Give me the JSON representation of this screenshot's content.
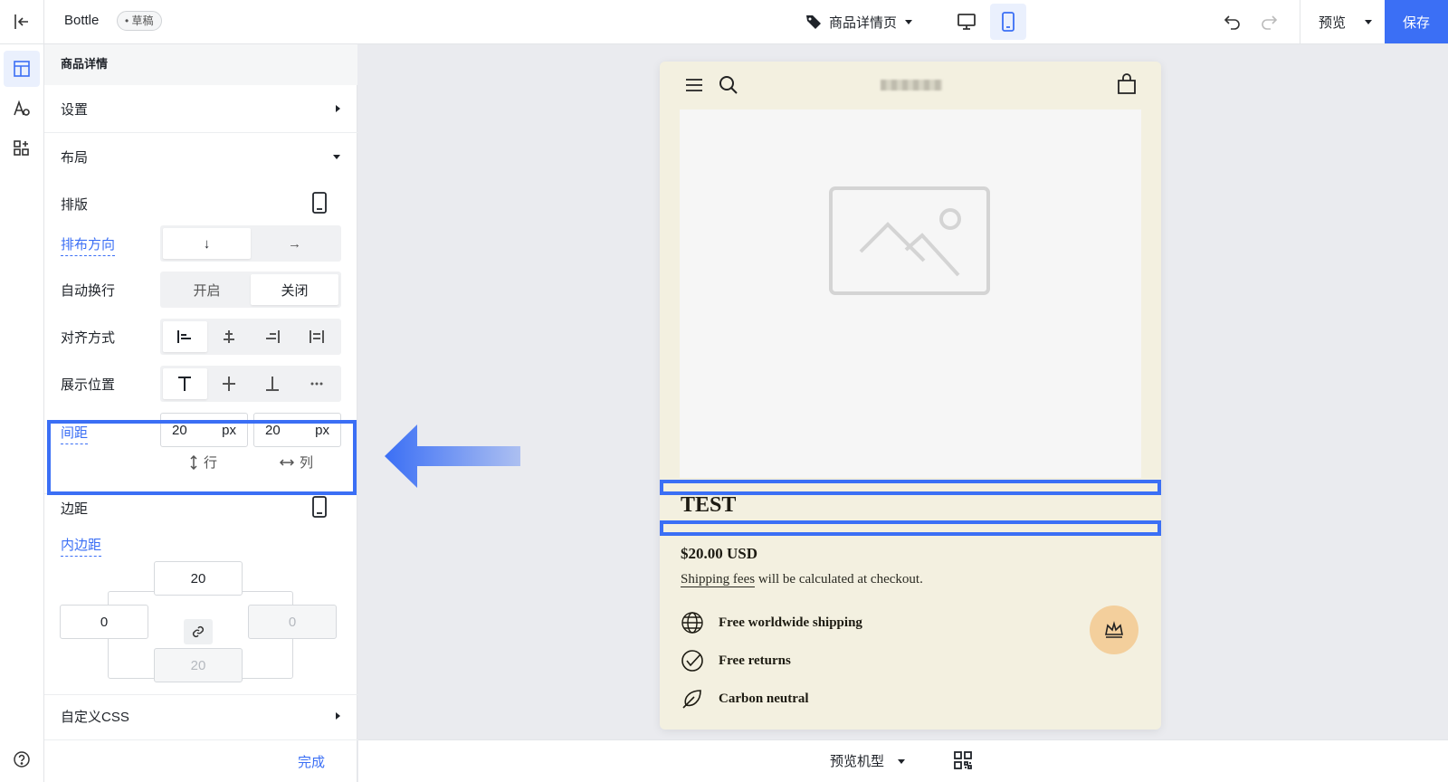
{
  "topbar": {
    "app_name": "Bottle",
    "draft_badge": "• 草稿",
    "page_selector": "商品详情页",
    "preview_label": "预览",
    "save_label": "保存"
  },
  "panel": {
    "header": "商品详情",
    "settings": "设置",
    "layout": "布局",
    "typesetting": "排版",
    "direction_label": "排布方向",
    "direction_options": [
      "↓",
      "→"
    ],
    "wrap_label": "自动换行",
    "wrap_options": [
      "开启",
      "关闭"
    ],
    "wrap_selected": "关闭",
    "align_label": "对齐方式",
    "position_label": "展示位置",
    "gap_label": "间距",
    "gap_row_value": "20",
    "gap_col_value": "20",
    "unit": "px",
    "row_label": "行",
    "col_label": "列",
    "margin_section": "边距",
    "padding_label": "内边距",
    "padding_top": "20",
    "padding_left": "0",
    "padding_right": "0",
    "padding_bottom": "20",
    "custom_css": "自定义CSS",
    "done": "完成"
  },
  "bottombar": {
    "device_model": "预览机型"
  },
  "preview": {
    "product_title": "TEST",
    "price": "$20.00 USD",
    "shipping_link": "Shipping fees",
    "shipping_rest": " will be calculated at checkout.",
    "features": [
      "Free worldwide shipping",
      "Free returns",
      "Carbon neutral"
    ]
  },
  "colors": {
    "accent": "#3b6ff5",
    "phone_bg": "#f3f0e0",
    "crown_bg": "#f3cf9c"
  }
}
